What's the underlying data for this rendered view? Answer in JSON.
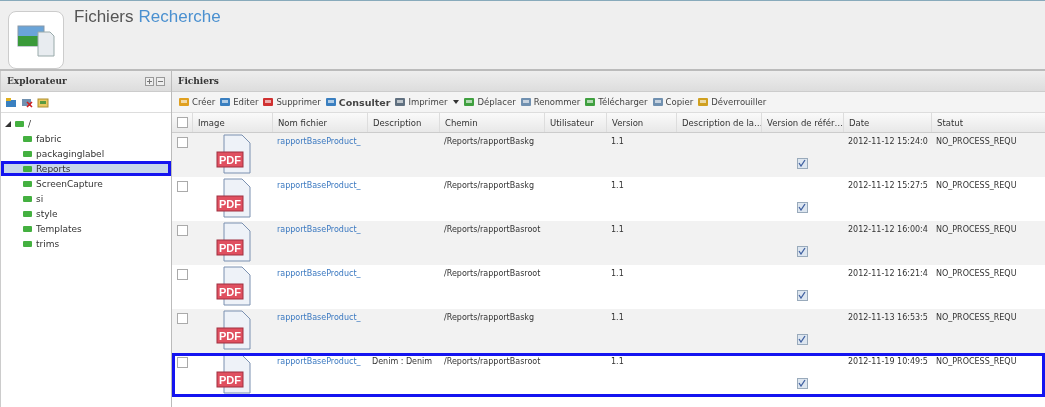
{
  "header": {
    "title_main": "Fichiers",
    "title_accent": "Recherche"
  },
  "explorer": {
    "title": "Explorateur",
    "tree": [
      {
        "label": "/",
        "expanded": true,
        "selected": false,
        "highlighted": false,
        "children": [
          {
            "label": "fabric",
            "selected": false,
            "highlighted": false
          },
          {
            "label": "packaginglabel",
            "selected": false,
            "highlighted": false
          },
          {
            "label": "Reports",
            "selected": true,
            "highlighted": true
          },
          {
            "label": "ScreenCapture",
            "selected": false,
            "highlighted": false
          },
          {
            "label": "si",
            "selected": false,
            "highlighted": false
          },
          {
            "label": "style",
            "selected": false,
            "highlighted": false
          },
          {
            "label": "Templates",
            "selected": false,
            "highlighted": false
          },
          {
            "label": "trims",
            "selected": false,
            "highlighted": false
          }
        ]
      }
    ]
  },
  "files": {
    "title": "Fichiers",
    "toolbar": [
      {
        "label": "Créer",
        "kind": "create",
        "bold": false,
        "dropdown": false
      },
      {
        "label": "Editer",
        "kind": "edit",
        "bold": false,
        "dropdown": false
      },
      {
        "label": "Supprimer",
        "kind": "delete",
        "bold": false,
        "dropdown": false
      },
      {
        "label": "Consulter",
        "kind": "view",
        "bold": true,
        "dropdown": false
      },
      {
        "label": "Imprimer",
        "kind": "print",
        "bold": false,
        "dropdown": true
      },
      {
        "label": "Déplacer",
        "kind": "move",
        "bold": false,
        "dropdown": false
      },
      {
        "label": "Renommer",
        "kind": "rename",
        "bold": false,
        "dropdown": false
      },
      {
        "label": "Télécharger",
        "kind": "download",
        "bold": false,
        "dropdown": false
      },
      {
        "label": "Copier",
        "kind": "copy",
        "bold": false,
        "dropdown": false
      },
      {
        "label": "Déverrouiller",
        "kind": "unlock",
        "bold": false,
        "dropdown": false
      }
    ],
    "columns": [
      "Image",
      "Nom fichier",
      "Description",
      "Chemin",
      "Utilisateur",
      "Version",
      "Description de la…",
      "Version de référ…",
      "Date",
      "Statut"
    ],
    "header_checked": false,
    "rows": [
      {
        "checked": false,
        "highlighted": false,
        "file_type": "PDF",
        "name": "rapportBaseProduct_",
        "path": "/Reports/rapportBaskg",
        "version": "1.1",
        "reference": true,
        "date": "2012-11-12 15:24:0",
        "status": "NO_PROCESS_REQU"
      },
      {
        "checked": false,
        "highlighted": false,
        "file_type": "PDF",
        "name": "rapportBaseProduct_",
        "path": "/Reports/rapportBaskg",
        "version": "1.1",
        "reference": true,
        "date": "2012-11-12 15:27:5",
        "status": "NO_PROCESS_REQU"
      },
      {
        "checked": false,
        "highlighted": false,
        "file_type": "PDF",
        "name": "rapportBaseProduct_",
        "path": "/Reports/rapportBasroot",
        "version": "1.1",
        "reference": true,
        "date": "2012-11-12 16:00:4",
        "status": "NO_PROCESS_REQU"
      },
      {
        "checked": false,
        "highlighted": false,
        "file_type": "PDF",
        "name": "rapportBaseProduct_",
        "path": "/Reports/rapportBasroot",
        "version": "1.1",
        "reference": true,
        "date": "2012-11-12 16:21:4",
        "status": "NO_PROCESS_REQU"
      },
      {
        "checked": false,
        "highlighted": false,
        "file_type": "PDF",
        "name": "rapportBaseProduct_",
        "path": "/Reports/rapportBaskg",
        "version": "1.1",
        "reference": true,
        "date": "2012-11-13 16:53:5",
        "status": "NO_PROCESS_REQU"
      },
      {
        "checked": false,
        "highlighted": true,
        "file_type": "PDF",
        "name": "rapportBaseProduct_",
        "description": "Denim : Denim",
        "path": "/Reports/rapportBasroot",
        "version": "1.1",
        "reference": true,
        "date": "2012-11-19 10:49:5",
        "status": "NO_PROCESS_REQU"
      }
    ]
  }
}
